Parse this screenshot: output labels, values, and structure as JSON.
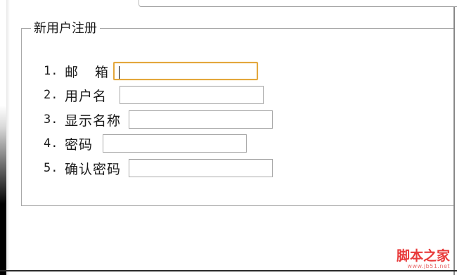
{
  "form": {
    "legend": "新用户注册",
    "rows": [
      {
        "number": "1.",
        "label": "邮 箱",
        "value": "",
        "focused": true
      },
      {
        "number": "2.",
        "label": "用户名",
        "value": ""
      },
      {
        "number": "3.",
        "label": "显示名称",
        "value": ""
      },
      {
        "number": "4.",
        "label": "密码",
        "value": ""
      },
      {
        "number": "5.",
        "label": "确认密码",
        "value": ""
      }
    ]
  },
  "watermark": {
    "main": "脚本之家",
    "sub": "www.jb51.net"
  },
  "colors": {
    "focus_border": "#e3a73c",
    "input_border": "#aaaaaa",
    "fieldset_border": "#a9a9a9",
    "watermark": "#e83a3a"
  }
}
